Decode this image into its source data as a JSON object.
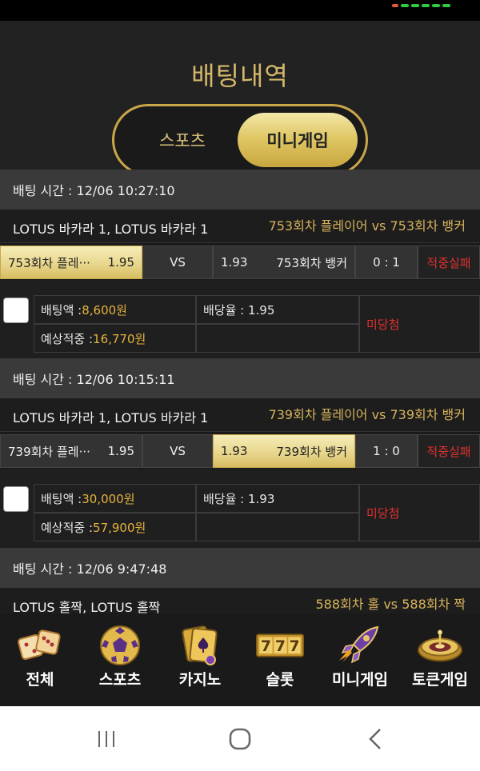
{
  "page": {
    "title": "배팅내역"
  },
  "tabs": {
    "left": "스포츠",
    "right": "미니게임",
    "active": "미니게임"
  },
  "bets": [
    {
      "time_label": "배팅 시간 : 12/06 10:27:10",
      "game": "LOTUS 바카라 1, LOTUS 바카라 1",
      "match": "753회차 플레이어  vs  753회차 뱅커",
      "home_name": "753회차 플레···",
      "home_odds": "1.95",
      "vs": "VS",
      "away_odds": "1.93",
      "away_name": "753회차 뱅커",
      "score": "0 : 1",
      "status": "적중실패",
      "selected": "home",
      "bet_amount_label": "배팅액 : ",
      "bet_amount": "8,600원",
      "odds_label": "배당율 : 1.95",
      "expected_label": "예상적중 : ",
      "expected": "16,770원",
      "result": "미당첨"
    },
    {
      "time_label": "배팅 시간 : 12/06 10:15:11",
      "game": "LOTUS 바카라 1, LOTUS 바카라 1",
      "match": "739회차 플레이어  vs  739회차 뱅커",
      "home_name": "739회차 플레···",
      "home_odds": "1.95",
      "vs": "VS",
      "away_odds": "1.93",
      "away_name": "739회차 뱅커",
      "score": "1 : 0",
      "status": "적중실패",
      "selected": "away",
      "bet_amount_label": "배팅액 : ",
      "bet_amount": "30,000원",
      "odds_label": "배당율 : 1.93",
      "expected_label": "예상적중 : ",
      "expected": "57,900원",
      "result": "미당첨"
    },
    {
      "time_label": "배팅 시간 : 12/06 9:47:48",
      "game": "LOTUS 홀짝, LOTUS 홀짝",
      "match": "588회차 홀  vs  588회차 짝"
    }
  ],
  "bottom_nav": [
    {
      "label": "전체",
      "icon": "dice-icon"
    },
    {
      "label": "스포츠",
      "icon": "soccer-ball-icon"
    },
    {
      "label": "카지노",
      "icon": "casino-cards-icon"
    },
    {
      "label": "슬롯",
      "icon": "slot-777-icon"
    },
    {
      "label": "미니게임",
      "icon": "rocket-icon"
    },
    {
      "label": "토큰게임",
      "icon": "roulette-icon"
    }
  ],
  "system_nav": {
    "recents": "|||",
    "home": "○",
    "back": "<"
  },
  "colors": {
    "gold": "#d4b86a",
    "red": "#e03030",
    "accent_amount": "#e6b33c"
  }
}
